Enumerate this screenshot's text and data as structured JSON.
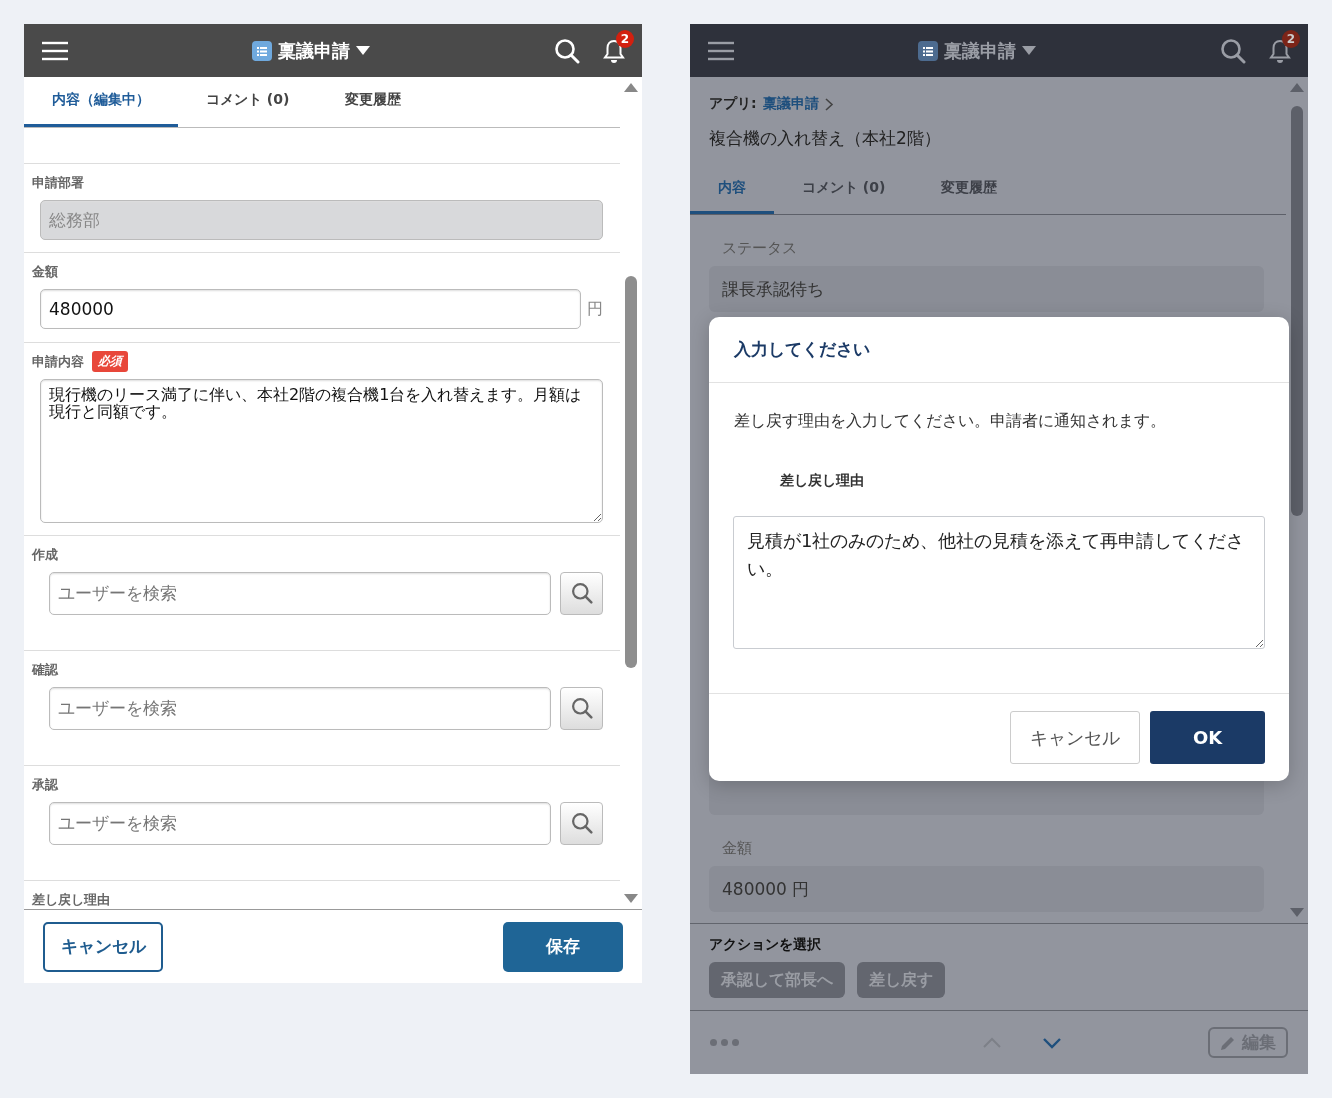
{
  "edit_screen": {
    "header": {
      "title": "稟議申請",
      "notification_count": "2"
    },
    "tabs": [
      {
        "label": "内容（編集中）",
        "selected": true
      },
      {
        "label": "コメント (0)",
        "selected": false
      },
      {
        "label": "変更履歴",
        "selected": false
      }
    ],
    "fields": [
      {
        "kind": "readonly",
        "label": "申請部署",
        "value": "総務部"
      },
      {
        "kind": "number",
        "label": "金額",
        "value": "480000",
        "unit": "円"
      },
      {
        "kind": "textarea",
        "label": "申請内容",
        "required_badge": "必須",
        "value": "現行機のリース満了に伴い、本社2階の複合機1台を入れ替えます。月額は現行と同額です。"
      },
      {
        "kind": "user",
        "label": "作成",
        "placeholder": "ユーザーを検索"
      },
      {
        "kind": "user",
        "label": "確認",
        "placeholder": "ユーザーを検索"
      },
      {
        "kind": "user",
        "label": "承認",
        "placeholder": "ユーザーを検索"
      },
      {
        "kind": "label_only",
        "label": "差し戻し理由"
      }
    ],
    "footer": {
      "cancel": "キャンセル",
      "save": "保存"
    }
  },
  "detail_screen": {
    "header": {
      "title": "稟議申請",
      "notification_count": "2"
    },
    "breadcrumb": {
      "prefix": "アプリ:",
      "app": "稟議申請"
    },
    "record_title": "複合機の入れ替え（本社2階）",
    "tabs": [
      {
        "label": "内容",
        "selected": true
      },
      {
        "label": "コメント (0)",
        "selected": false
      },
      {
        "label": "変更履歴",
        "selected": false
      }
    ],
    "status": {
      "label": "ステータス",
      "value": "課長承認待ち"
    },
    "amount": {
      "label": "金額",
      "value": "480000 円"
    },
    "action_section": {
      "title": "アクションを選択",
      "actions": [
        "承認して部長へ",
        "差し戻す"
      ]
    },
    "bottom_bar": {
      "edit": "編集"
    }
  },
  "dialog": {
    "title": "入力してください",
    "message": "差し戻す理由を入力してください。申請者に通知されます。",
    "field_label": "差し戻し理由",
    "value": "見積が1社のみのため、他社の見積を添えて再申請してください。",
    "buttons": [
      {
        "label": "キャンセル",
        "kind": "secondary"
      },
      {
        "label": "OK",
        "kind": "primary"
      }
    ]
  }
}
